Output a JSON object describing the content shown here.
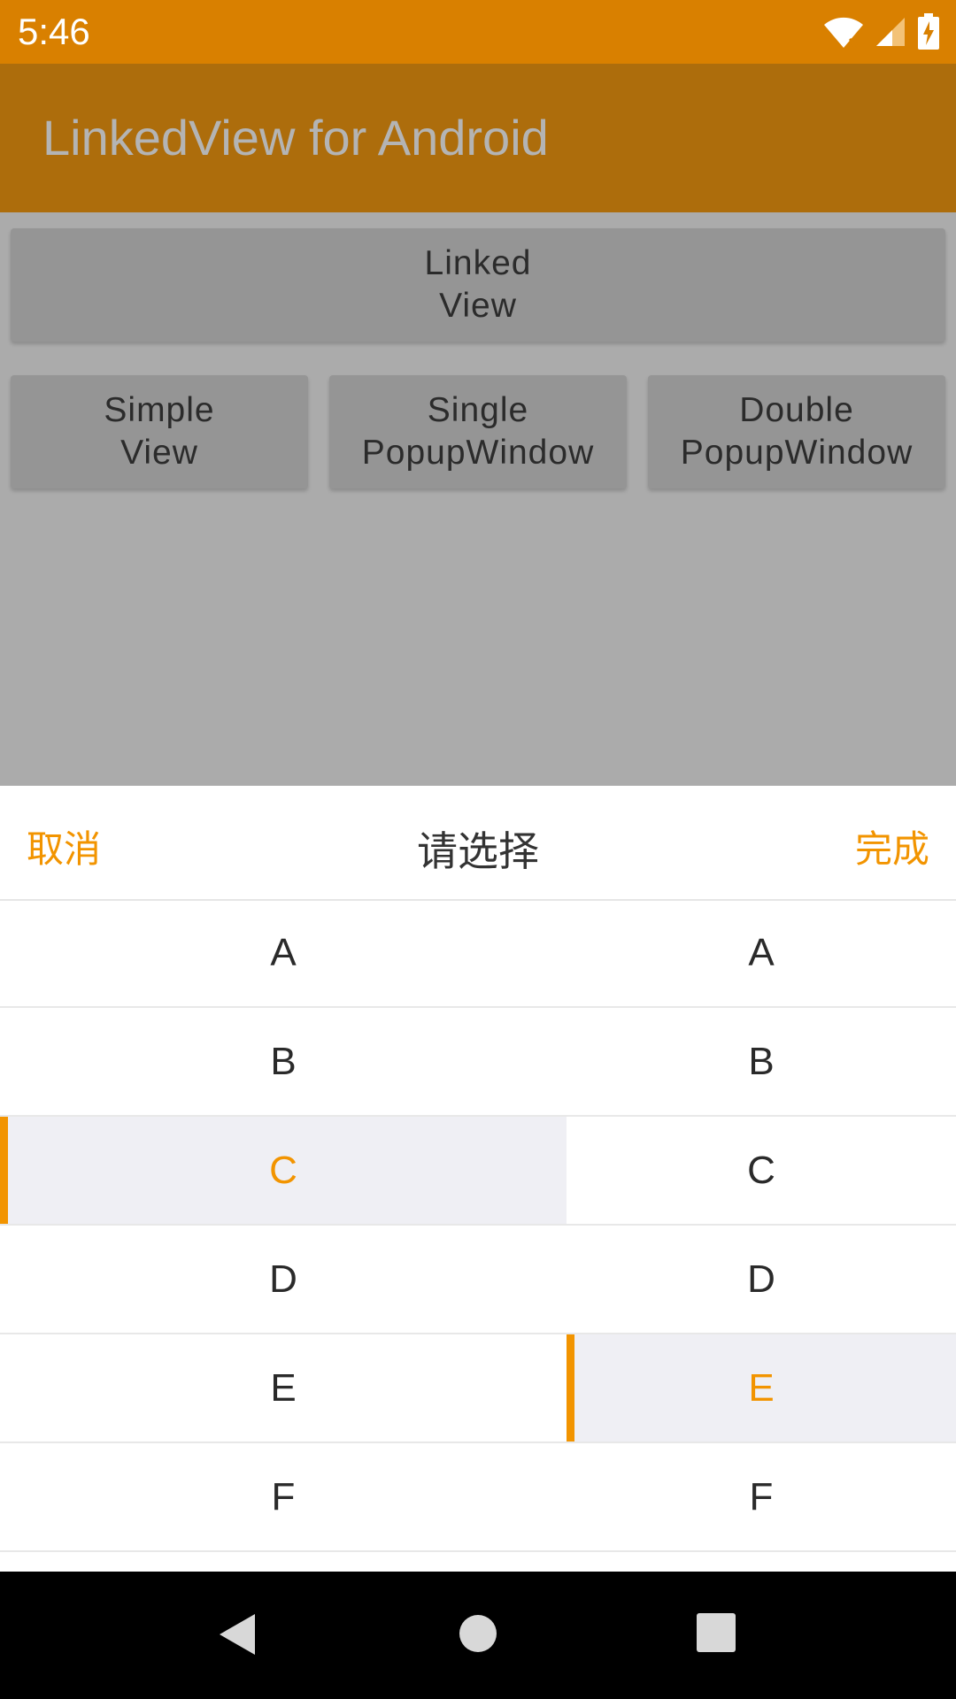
{
  "status_bar": {
    "time": "5:46",
    "icons": [
      "wifi-icon",
      "signal-icon",
      "battery-charging-icon"
    ],
    "background": "#d98000"
  },
  "app_bar": {
    "title": "LinkedView for Android",
    "background": "#ad6d0c"
  },
  "buttons": {
    "linked_view": "Linked\nView",
    "simple_view": "Simple\nView",
    "single_popup": "Single\nPopupWindow",
    "double_popup": "Double\nPopupWindow"
  },
  "picker": {
    "cancel_label": "取消",
    "title": "请选择",
    "done_label": "完成",
    "accent_color": "#f29400",
    "left_items": [
      "A",
      "B",
      "C",
      "D",
      "E",
      "F"
    ],
    "left_selected": "C",
    "right_items": [
      "A",
      "B",
      "C",
      "D",
      "E",
      "F"
    ],
    "right_selected": "E"
  },
  "nav_bar": {
    "icons": [
      "back-icon",
      "home-icon",
      "recent-apps-icon"
    ]
  }
}
